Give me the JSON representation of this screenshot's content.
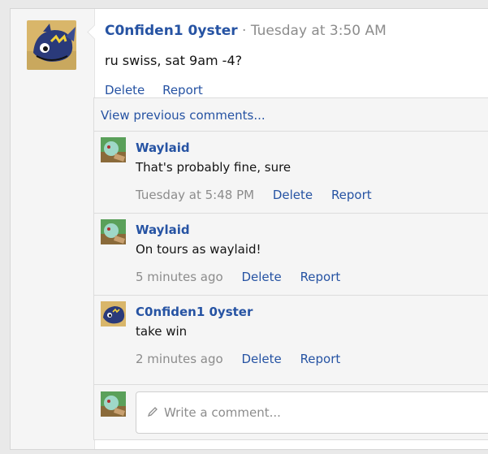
{
  "post": {
    "author": "C0nfiden1 0yster",
    "separator": "·",
    "timestamp": "Tuesday at 3:50 AM",
    "body": "ru swiss, sat 9am -4?",
    "actions": {
      "delete": "Delete",
      "report": "Report"
    }
  },
  "comments": {
    "view_previous": "View previous comments...",
    "items": [
      {
        "author": "Waylaid",
        "text": "That's probably fine, sure",
        "time": "Tuesday at 5:48 PM",
        "delete": "Delete",
        "report": "Report"
      },
      {
        "author": "Waylaid",
        "text": "On tours as waylaid!",
        "time": "5 minutes ago",
        "delete": "Delete",
        "report": "Report"
      },
      {
        "author": "C0nfiden1 0yster",
        "text": "take win",
        "time": "2 minutes ago",
        "delete": "Delete",
        "report": "Report"
      }
    ],
    "reply_placeholder": "Write a comment..."
  },
  "colors": {
    "link": "#2653a3",
    "muted": "#8c8c8c",
    "panel": "#f5f5f5"
  }
}
